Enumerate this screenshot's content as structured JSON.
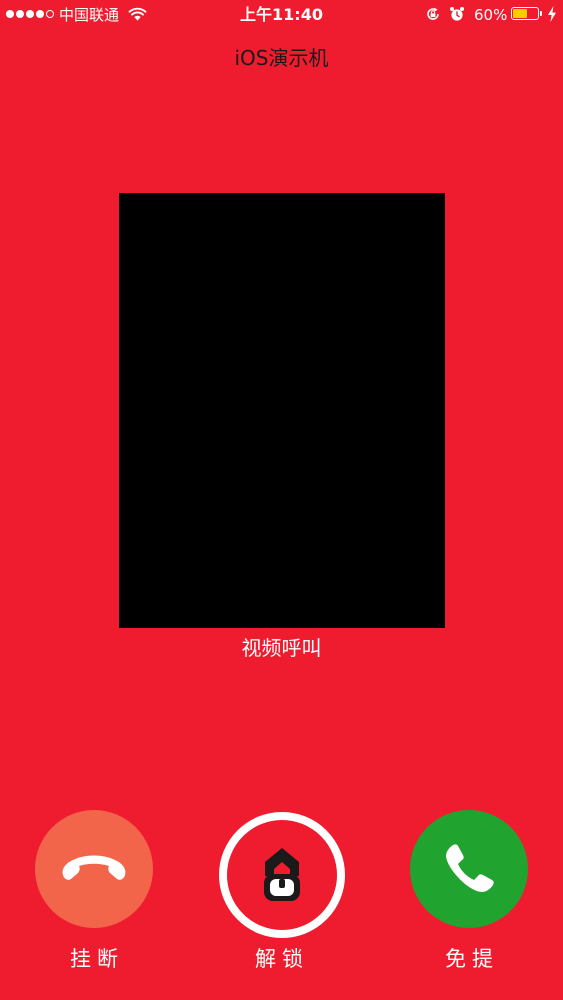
{
  "status_bar": {
    "carrier": "中国联通",
    "time": "上午11:40",
    "battery_percent": "60%",
    "battery_level": 0.6,
    "battery_color": "#FFCC00",
    "signal_bars_filled": 4,
    "signal_bars_total": 5
  },
  "header": {
    "title": "iOS演示机"
  },
  "call": {
    "type_label": "视频呼叫"
  },
  "actions": {
    "hangup_label": "挂断",
    "unlock_label": "解锁",
    "speaker_label": "免提"
  },
  "colors": {
    "background": "#EE1C2E",
    "hangup": "#F2654A",
    "speaker": "#21A32F",
    "video": "#000000"
  },
  "icons": {
    "hangup": "phone-hangup-icon",
    "unlock": "unlock-icon",
    "speaker": "phone-icon"
  }
}
